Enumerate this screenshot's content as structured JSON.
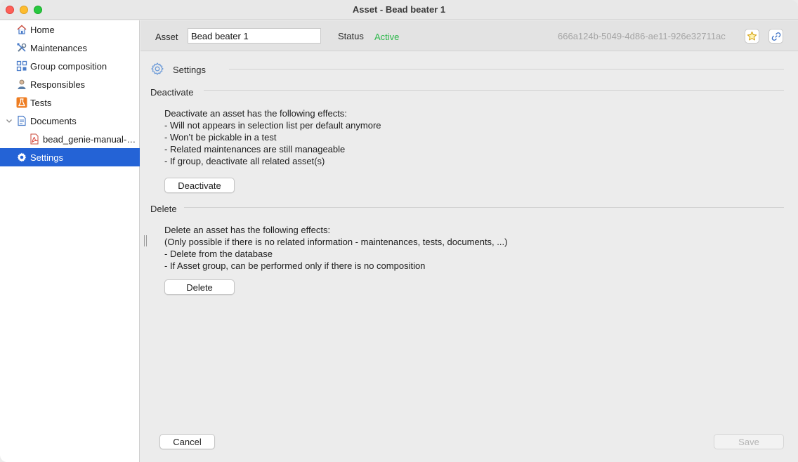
{
  "window": {
    "title": "Asset - Bead beater 1"
  },
  "sidebar": {
    "items": [
      {
        "label": "Home"
      },
      {
        "label": "Maintenances"
      },
      {
        "label": "Group composition"
      },
      {
        "label": "Responsibles"
      },
      {
        "label": "Tests"
      },
      {
        "label": "Documents"
      },
      {
        "label": "bead_genie-manual-w..."
      },
      {
        "label": "Settings"
      }
    ]
  },
  "header": {
    "asset_label": "Asset",
    "asset_value": "Bead beater 1",
    "status_label": "Status",
    "status_value": "Active",
    "id": "666a124b-5049-4d86-ae11-926e32711ac"
  },
  "settings": {
    "title": "Settings",
    "deactivate": {
      "title": "Deactivate",
      "lines": [
        "Deactivate an asset has the following effects:",
        "- Will not appears in selection list per default anymore",
        "- Won’t be pickable in a test",
        "- Related maintenances are still manageable",
        "- If group, deactivate all related asset(s)"
      ],
      "button": "Deactivate"
    },
    "delete": {
      "title": "Delete",
      "lines": [
        "Delete an asset has the following effects:",
        "(Only possible if there is no related information - maintenances, tests, documents, ...)",
        "- Delete from the database",
        "- If Asset group, can be performed only if there is no composition"
      ],
      "button": "Delete"
    }
  },
  "footer": {
    "cancel": "Cancel",
    "save": "Save"
  },
  "colors": {
    "accent": "#2463d6",
    "status_active": "#2db84b"
  }
}
